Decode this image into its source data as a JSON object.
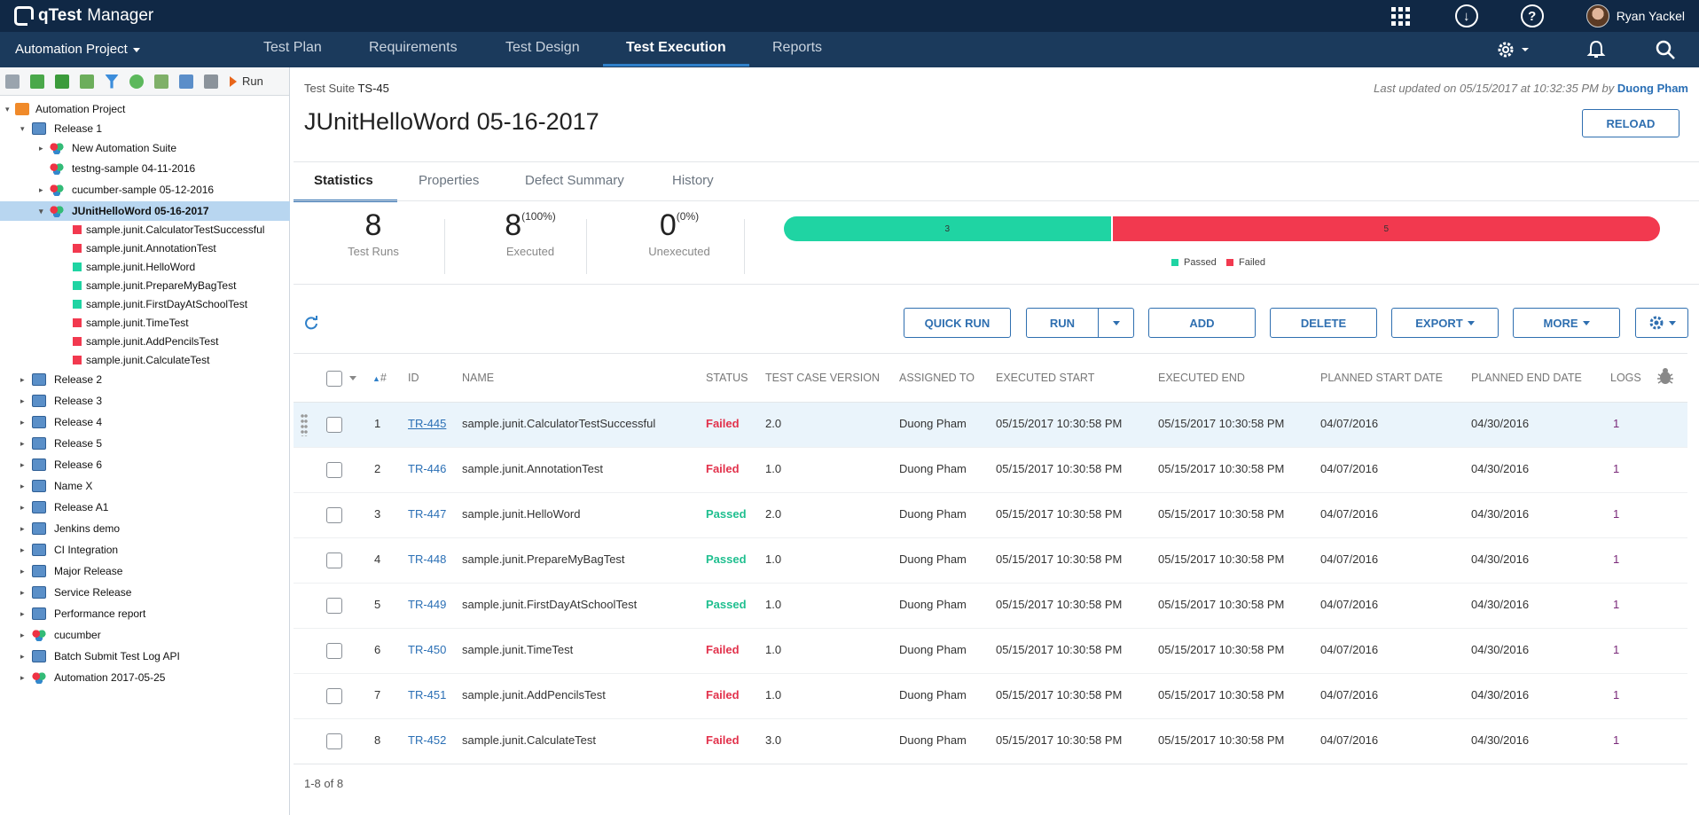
{
  "app": {
    "brand": "qTest",
    "product": "Manager"
  },
  "user": {
    "name": "Ryan Yackel"
  },
  "nav": {
    "project": "Automation Project",
    "tabs": [
      "Test Plan",
      "Requirements",
      "Test Design",
      "Test Execution",
      "Reports"
    ],
    "active_tab": "Test Execution"
  },
  "toolbar": {
    "run_label": "Run"
  },
  "tree": {
    "root": "Automation Project",
    "release1": "Release 1",
    "release1_children": [
      "New Automation Suite",
      "testng-sample 04-11-2016",
      "cucumber-sample 05-12-2016",
      "JUnitHelloWord 05-16-2017"
    ],
    "suite_children": [
      {
        "label": "sample.junit.CalculatorTestSuccessful",
        "status": "failed"
      },
      {
        "label": "sample.junit.AnnotationTest",
        "status": "failed"
      },
      {
        "label": "sample.junit.HelloWord",
        "status": "passed"
      },
      {
        "label": "sample.junit.PrepareMyBagTest",
        "status": "passed"
      },
      {
        "label": "sample.junit.FirstDayAtSchoolTest",
        "status": "passed"
      },
      {
        "label": "sample.junit.TimeTest",
        "status": "failed"
      },
      {
        "label": "sample.junit.AddPencilsTest",
        "status": "failed"
      },
      {
        "label": "sample.junit.CalculateTest",
        "status": "failed"
      }
    ],
    "other_nodes": [
      "Release 2",
      "Release 3",
      "Release 4",
      "Release 5",
      "Release 6",
      "Name X",
      "Release A1",
      "Jenkins demo",
      "CI Integration",
      "Major Release",
      "Service Release",
      "Performance report",
      "cucumber",
      "Batch Submit Test Log API",
      "Automation 2017-05-25"
    ]
  },
  "suite": {
    "id_label": "Test Suite",
    "id": "TS-45",
    "title": "JUnitHelloWord 05-16-2017",
    "updated_prefix": "Last updated on 05/15/2017 at 10:32:35 PM by",
    "updated_by": "Duong Pham",
    "reload": "RELOAD"
  },
  "tabs": [
    "Statistics",
    "Properties",
    "Defect Summary",
    "History"
  ],
  "stats": {
    "test_runs": "8",
    "test_runs_label": "Test Runs",
    "executed": "8",
    "executed_pct": "(100%)",
    "executed_label": "Executed",
    "unexecuted": "0",
    "unexecuted_pct": "(0%)",
    "unexecuted_label": "Unexecuted",
    "passed": 3,
    "failed": 5,
    "passed_label": "Passed",
    "failed_label": "Failed"
  },
  "colors": {
    "passed": "#1fd4a3",
    "failed": "#f2394f",
    "accent": "#2f6fb0",
    "topbar": "#102845"
  },
  "actions": {
    "quick_run": "QUICK RUN",
    "run": "RUN",
    "add": "ADD",
    "delete": "DELETE",
    "export": "EXPORT",
    "more": "MORE"
  },
  "table": {
    "headers": [
      "#",
      "ID",
      "NAME",
      "STATUS",
      "TEST CASE VERSION",
      "ASSIGNED TO",
      "EXECUTED START",
      "EXECUTED END",
      "PLANNED START DATE",
      "PLANNED END DATE",
      "LOGS"
    ],
    "rows": [
      {
        "n": "1",
        "id": "TR-445",
        "name": "sample.junit.CalculatorTestSuccessful",
        "status": "Failed",
        "version": "2.0",
        "assigned": "Duong Pham",
        "start": "05/15/2017 10:30:58 PM",
        "end": "05/15/2017 10:30:58 PM",
        "pstart": "04/07/2016",
        "pend": "04/30/2016",
        "logs": "1"
      },
      {
        "n": "2",
        "id": "TR-446",
        "name": "sample.junit.AnnotationTest",
        "status": "Failed",
        "version": "1.0",
        "assigned": "Duong Pham",
        "start": "05/15/2017 10:30:58 PM",
        "end": "05/15/2017 10:30:58 PM",
        "pstart": "04/07/2016",
        "pend": "04/30/2016",
        "logs": "1"
      },
      {
        "n": "3",
        "id": "TR-447",
        "name": "sample.junit.HelloWord",
        "status": "Passed",
        "version": "2.0",
        "assigned": "Duong Pham",
        "start": "05/15/2017 10:30:58 PM",
        "end": "05/15/2017 10:30:58 PM",
        "pstart": "04/07/2016",
        "pend": "04/30/2016",
        "logs": "1"
      },
      {
        "n": "4",
        "id": "TR-448",
        "name": "sample.junit.PrepareMyBagTest",
        "status": "Passed",
        "version": "1.0",
        "assigned": "Duong Pham",
        "start": "05/15/2017 10:30:58 PM",
        "end": "05/15/2017 10:30:58 PM",
        "pstart": "04/07/2016",
        "pend": "04/30/2016",
        "logs": "1"
      },
      {
        "n": "5",
        "id": "TR-449",
        "name": "sample.junit.FirstDayAtSchoolTest",
        "status": "Passed",
        "version": "1.0",
        "assigned": "Duong Pham",
        "start": "05/15/2017 10:30:58 PM",
        "end": "05/15/2017 10:30:58 PM",
        "pstart": "04/07/2016",
        "pend": "04/30/2016",
        "logs": "1"
      },
      {
        "n": "6",
        "id": "TR-450",
        "name": "sample.junit.TimeTest",
        "status": "Failed",
        "version": "1.0",
        "assigned": "Duong Pham",
        "start": "05/15/2017 10:30:58 PM",
        "end": "05/15/2017 10:30:58 PM",
        "pstart": "04/07/2016",
        "pend": "04/30/2016",
        "logs": "1"
      },
      {
        "n": "7",
        "id": "TR-451",
        "name": "sample.junit.AddPencilsTest",
        "status": "Failed",
        "version": "1.0",
        "assigned": "Duong Pham",
        "start": "05/15/2017 10:30:58 PM",
        "end": "05/15/2017 10:30:58 PM",
        "pstart": "04/07/2016",
        "pend": "04/30/2016",
        "logs": "1"
      },
      {
        "n": "8",
        "id": "TR-452",
        "name": "sample.junit.CalculateTest",
        "status": "Failed",
        "version": "3.0",
        "assigned": "Duong Pham",
        "start": "05/15/2017 10:30:58 PM",
        "end": "05/15/2017 10:30:58 PM",
        "pstart": "04/07/2016",
        "pend": "04/30/2016",
        "logs": "1"
      }
    ],
    "footer": "1-8 of 8"
  }
}
